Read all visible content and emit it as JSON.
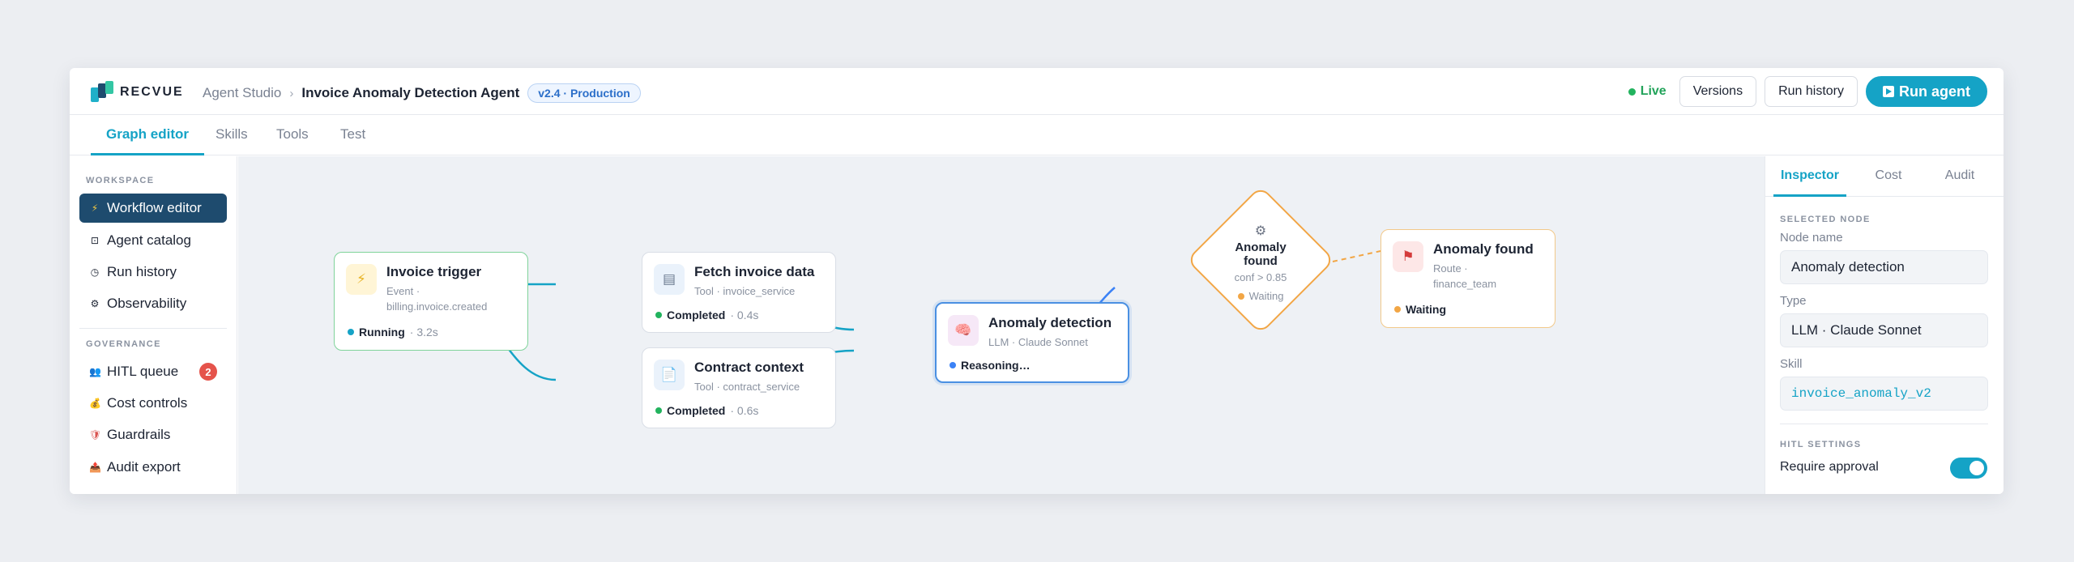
{
  "brand": {
    "name": "RECVUE"
  },
  "breadcrumb": {
    "parent": "Agent Studio",
    "separator": "›",
    "current": "Invoice Anomaly Detection Agent",
    "version": "v2.4 · Production"
  },
  "header": {
    "live_label": "Live",
    "versions_label": "Versions",
    "run_history_label": "Run history",
    "run_agent_label": "Run agent"
  },
  "tabs": [
    {
      "label": "Graph editor",
      "active": true
    },
    {
      "label": "Skills",
      "active": false
    },
    {
      "label": "Tools",
      "active": false
    },
    {
      "label": "Test",
      "active": false
    }
  ],
  "sidebar": {
    "workspace_title": "WORKSPACE",
    "workspace_items": [
      {
        "label": "Workflow editor",
        "icon": "lightning-icon",
        "active": true
      },
      {
        "label": "Agent catalog",
        "icon": "catalog-icon",
        "active": false
      },
      {
        "label": "Run history",
        "icon": "clock-icon",
        "active": false
      },
      {
        "label": "Observability",
        "icon": "gear-icon",
        "active": false
      }
    ],
    "governance_title": "GOVERNANCE",
    "governance_items": [
      {
        "label": "HITL queue",
        "icon": "people-icon",
        "badge": "2"
      },
      {
        "label": "Cost controls",
        "icon": "money-bag-icon"
      },
      {
        "label": "Guardrails",
        "icon": "shield-icon"
      },
      {
        "label": "Audit export",
        "icon": "export-icon"
      }
    ]
  },
  "graph": {
    "nodes": {
      "trigger": {
        "title": "Invoice trigger",
        "sub1": "Event ·",
        "sub2": "billing.invoice.created",
        "status": "Running",
        "time": "· 3.2s",
        "icon": "lightning-icon"
      },
      "fetch": {
        "title": "Fetch invoice data",
        "sub1": "Tool · invoice_service",
        "status": "Completed",
        "time": "· 0.4s",
        "icon": "database-icon"
      },
      "contract": {
        "title": "Contract context",
        "sub1": "Tool · contract_service",
        "status": "Completed",
        "time": "· 0.6s",
        "icon": "document-icon"
      },
      "anomaly": {
        "title": "Anomaly detection",
        "sub1": "LLM · Claude Sonnet",
        "status": "Reasoning…",
        "icon": "brain-icon"
      },
      "decision": {
        "title_line1": "Anomaly",
        "title_line2": "found",
        "sub": "conf > 0.85",
        "status": "Waiting",
        "icon": "gear-icon"
      },
      "route": {
        "title": "Anomaly found",
        "sub1": "Route ·",
        "sub2": "finance_team",
        "status": "Waiting",
        "icon": "flag-icon"
      }
    }
  },
  "inspector": {
    "tabs": [
      {
        "label": "Inspector",
        "active": true
      },
      {
        "label": "Cost",
        "active": false
      },
      {
        "label": "Audit",
        "active": false
      }
    ],
    "selected_title": "SELECTED NODE",
    "node_name_label": "Node name",
    "node_name_value": "Anomaly detection",
    "type_label": "Type",
    "type_value": "LLM · Claude Sonnet",
    "skill_label": "Skill",
    "skill_value": "invoice_anomaly_v2",
    "hitl_title": "HITL SETTINGS",
    "require_approval_label": "Require approval",
    "require_approval_on": true
  },
  "colors": {
    "accent": "#15a3c6",
    "navy": "#1e4b6e",
    "success": "#22b35e",
    "warning": "#f2a645",
    "info": "#3b82f6",
    "danger": "#e5534b"
  }
}
